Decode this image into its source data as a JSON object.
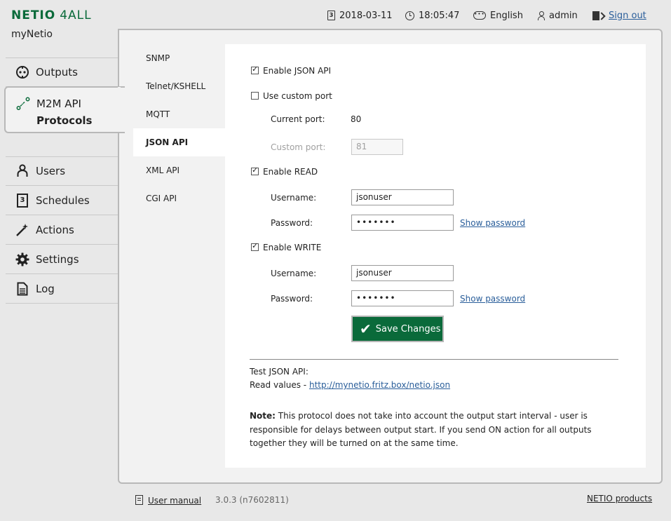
{
  "brand": {
    "logo_main": "NETIO",
    "logo_suffix": "4ALL",
    "device_name": "myNetio"
  },
  "topbar": {
    "date": "2018-03-11",
    "time": "18:05:47",
    "language": "English",
    "user": "admin",
    "signout": "Sign out",
    "calendar_glyph": "3"
  },
  "nav": {
    "outputs": "Outputs",
    "m2m_line1": "M2M API",
    "m2m_line2": "Protocols",
    "users": "Users",
    "schedules": "Schedules",
    "actions": "Actions",
    "settings": "Settings",
    "log": "Log",
    "schedules_glyph": "3"
  },
  "subtabs": [
    "SNMP",
    "Telnet/KSHELL",
    "MQTT",
    "JSON API",
    "XML API",
    "CGI API"
  ],
  "form": {
    "enable_json": {
      "label": "Enable JSON API",
      "checked": true
    },
    "custom_port_enable": {
      "label": "Use custom port",
      "checked": false
    },
    "current_port_label": "Current port:",
    "current_port_value": "80",
    "custom_port_label": "Custom port:",
    "custom_port_value": "81",
    "enable_read": {
      "label": "Enable READ",
      "checked": true
    },
    "read_username_label": "Username:",
    "read_username": "jsonuser",
    "read_password_label": "Password:",
    "read_password": "•••••••",
    "show_password": "Show password",
    "enable_write": {
      "label": "Enable WRITE",
      "checked": true
    },
    "write_username_label": "Username:",
    "write_username": "jsonuser",
    "write_password_label": "Password:",
    "write_password": "•••••••",
    "save": "Save Changes"
  },
  "test": {
    "title": "Test JSON API:",
    "read_prefix": "Read values - ",
    "read_link": "http://mynetio.fritz.box/netio.json"
  },
  "note": {
    "label": "Note:",
    "text": "This protocol does not take into account the output start interval - user is responsible for delays between output start. If you send ON action for all outputs together they will be turned on at the same time."
  },
  "footer": {
    "manual": "User manual",
    "version": "3.0.3 (n7602811)",
    "products": "NETIO products"
  },
  "colors": {
    "brand_green": "#0a6a3a",
    "link": "#2a5e9a",
    "panel": "#f2f2f2"
  }
}
